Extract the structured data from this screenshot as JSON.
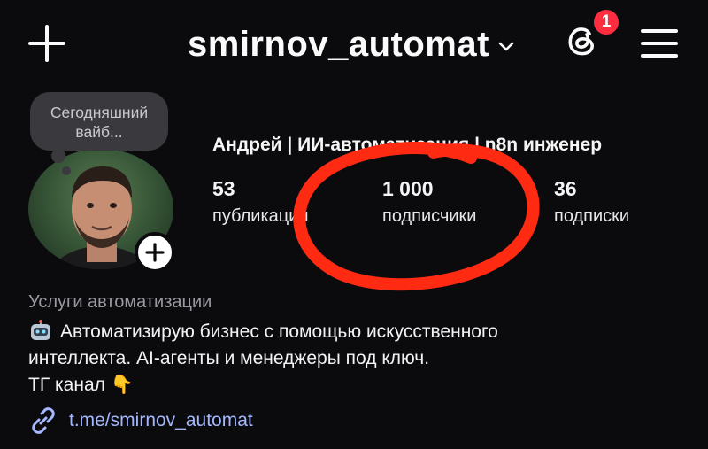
{
  "header": {
    "username": "smirnov_automat",
    "notification_count": "1",
    "icons": {
      "new_post": "plus-icon",
      "username_menu": "chevron-down-icon",
      "threads": "threads-icon",
      "menu": "hamburger-menu-icon"
    }
  },
  "profile": {
    "note_text": "Сегодняшний вайб...",
    "display_name": "Андрей | ИИ-автоматизация | n8n инженер",
    "stats": [
      {
        "value": "53",
        "label": "публикации"
      },
      {
        "value": "1 000",
        "label": "подписчики"
      },
      {
        "value": "36",
        "label": "подписки"
      }
    ],
    "category": "Услуги автоматизации",
    "bio_lines": [
      "Автоматизирую бизнес с помощью искусственного",
      "интеллекта. AI-агенты и менеджеры под ключ.",
      "ТГ канал"
    ],
    "bio_emojis": {
      "first_line": "robot-emoji",
      "third_line": "👇"
    },
    "link": "t.me/smirnov_automat"
  },
  "colors": {
    "background": "#0b0b0e",
    "badge": "#ff2d3f",
    "link": "#a5b8ff",
    "muted_text": "#9a9aa0",
    "annotation_circle": "#ff2a12"
  }
}
